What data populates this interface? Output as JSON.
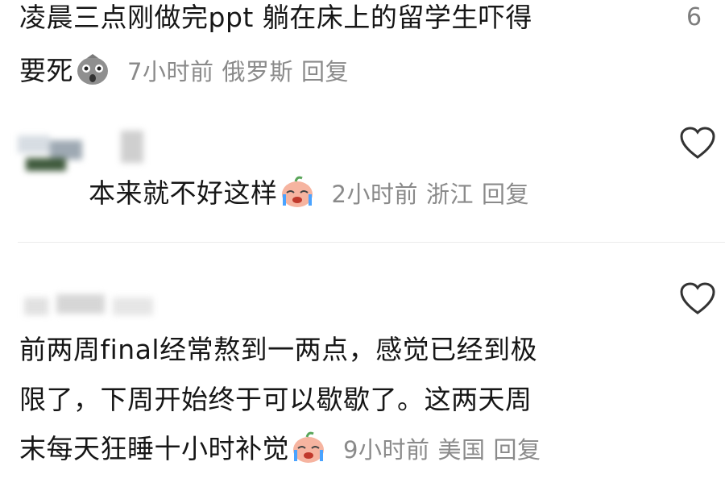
{
  "comments": [
    {
      "text_line1": "凌晨三点刚做完ppt 躺在床上的留学生吓得",
      "text_line2": "要死",
      "emoji": "scared-face-emoji",
      "time": "7小时前",
      "location": "俄罗斯",
      "reply": "回复",
      "likes": "6"
    },
    {
      "text": "本来就不好这样",
      "emoji": "crying-face-emoji",
      "time": "2小时前",
      "location": "浙江",
      "reply": "回复"
    },
    {
      "text_line1": "前两周final经常熬到一两点，感觉已经到极",
      "text_line2": "限了，下周开始终于可以歇歇了。这两天周",
      "text_line3": "末每天狂睡十小时补觉",
      "emoji": "crying-face-emoji",
      "time": "9小时前",
      "location": "美国",
      "reply": "回复"
    }
  ],
  "icons": {
    "like": "heart-outline-icon"
  }
}
